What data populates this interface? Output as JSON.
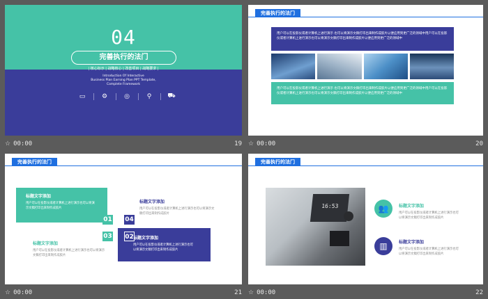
{
  "slides": [
    {
      "number": "19",
      "time": "00:00",
      "big_number": "04",
      "title": "完善执行的法门",
      "subtitle": "| 核心标示 | 战略核心 | 改善项目 | 战略要求 |",
      "intro_lines": [
        "Introduction Of Interactive",
        "Business Plan Earning Plan PPT Template,",
        "Complete Framework"
      ],
      "icons": [
        "monitor-icon",
        "gear-icon",
        "globe-icon",
        "search-icon",
        "truck-icon"
      ],
      "colors": {
        "teal": "#45c2a7",
        "indigo": "#3a3d9a"
      }
    },
    {
      "number": "20",
      "time": "00:00",
      "tag": "完善执行的法门",
      "box1_text": "用户可以在投影仪或者计算机上进行演示 也可以将演示文稿打印出来制作成胶片以便应用到更广泛的领域中用户可以在投影仪或者计算机上进行演示也可以将演示文稿打印出来制作成胶片以便应用到更广泛的领域中",
      "box2_text": "用户可以在投影仪或者计算机上进行演示 也可以将演示文稿打印出来制作成胶片以便应用到更广泛的领域中用户可以在投影仪或者计算机上进行演示也可以将演示文稿打印出来制作成胶片以便应用到更广泛的领域中"
    },
    {
      "number": "21",
      "time": "00:00",
      "tag": "完善执行的法门",
      "items": [
        {
          "badge": "01",
          "title": "标题文字添加",
          "text": "用户可以在投影仪或者计算机上进行演示也可以将演示文稿打印出来制作成胶片"
        },
        {
          "badge": "02",
          "title": "标题文字添加",
          "text": "用户可以在投影仪或者计算机上进行演示也可以将演示文稿打印出来制作成胶片"
        },
        {
          "badge": "03",
          "title": "标题文字添加",
          "text": "用户可以在投影仪或者计算机上进行演示也可以将演示文稿打印出来制作成胶片"
        },
        {
          "badge": "04",
          "title": "标题文字添加",
          "text": "用户可以在投影仪或者计算机上进行演示也可以将演示文稿打印出来制作成胶片"
        }
      ]
    },
    {
      "number": "22",
      "time": "00:00",
      "tag": "完善执行的法门",
      "clock_text": "16:53",
      "items": [
        {
          "icon": "people-icon",
          "title": "标题文字添加",
          "text": "用户可以在投影仪或者计算机上进行演示也可以将演示文稿打印出来制作成胶片"
        },
        {
          "icon": "chart-icon",
          "title": "标题文字添加",
          "text": "用户可以在投影仪或者计算机上进行演示也可以将演示文稿打印出来制作成胶片"
        }
      ]
    }
  ]
}
